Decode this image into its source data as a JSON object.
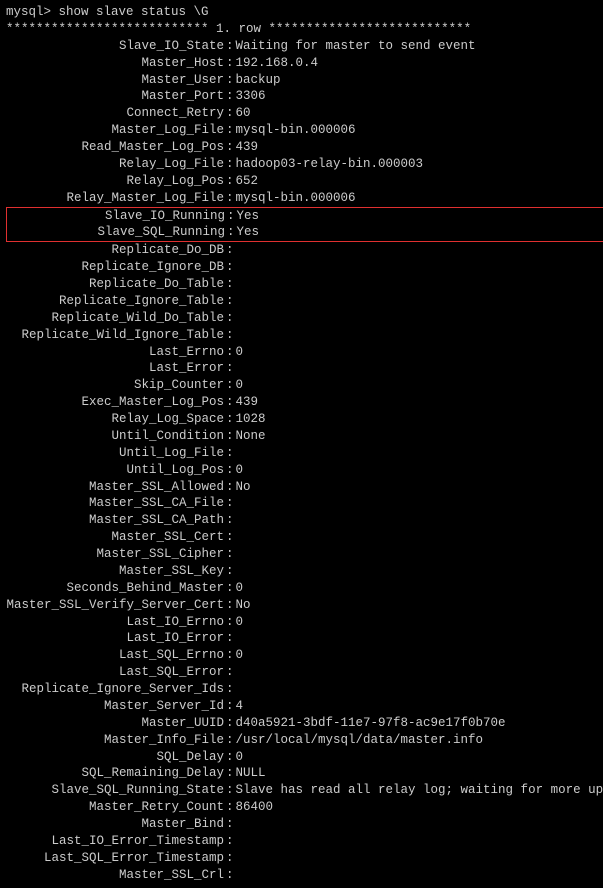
{
  "prompt": "mysql> show slave status \\G",
  "row_divider": "*************************** 1. row ***************************",
  "rows_before_box": [
    {
      "label": "Slave_IO_State",
      "value": "Waiting for master to send event"
    },
    {
      "label": "Master_Host",
      "value": "192.168.0.4"
    },
    {
      "label": "Master_User",
      "value": "backup"
    },
    {
      "label": "Master_Port",
      "value": "3306"
    },
    {
      "label": "Connect_Retry",
      "value": "60"
    },
    {
      "label": "Master_Log_File",
      "value": "mysql-bin.000006"
    },
    {
      "label": "Read_Master_Log_Pos",
      "value": "439"
    },
    {
      "label": "Relay_Log_File",
      "value": "hadoop03-relay-bin.000003"
    },
    {
      "label": "Relay_Log_Pos",
      "value": "652"
    },
    {
      "label": "Relay_Master_Log_File",
      "value": "mysql-bin.000006"
    }
  ],
  "rows_in_box": [
    {
      "label": "Slave_IO_Running",
      "value": "Yes"
    },
    {
      "label": "Slave_SQL_Running",
      "value": "Yes"
    }
  ],
  "rows_after_box": [
    {
      "label": "Replicate_Do_DB",
      "value": ""
    },
    {
      "label": "Replicate_Ignore_DB",
      "value": ""
    },
    {
      "label": "Replicate_Do_Table",
      "value": ""
    },
    {
      "label": "Replicate_Ignore_Table",
      "value": ""
    },
    {
      "label": "Replicate_Wild_Do_Table",
      "value": ""
    },
    {
      "label": "Replicate_Wild_Ignore_Table",
      "value": ""
    },
    {
      "label": "Last_Errno",
      "value": "0"
    },
    {
      "label": "Last_Error",
      "value": ""
    },
    {
      "label": "Skip_Counter",
      "value": "0"
    },
    {
      "label": "Exec_Master_Log_Pos",
      "value": "439"
    },
    {
      "label": "Relay_Log_Space",
      "value": "1028"
    },
    {
      "label": "Until_Condition",
      "value": "None"
    },
    {
      "label": "Until_Log_File",
      "value": ""
    },
    {
      "label": "Until_Log_Pos",
      "value": "0"
    },
    {
      "label": "Master_SSL_Allowed",
      "value": "No"
    },
    {
      "label": "Master_SSL_CA_File",
      "value": ""
    },
    {
      "label": "Master_SSL_CA_Path",
      "value": ""
    },
    {
      "label": "Master_SSL_Cert",
      "value": ""
    },
    {
      "label": "Master_SSL_Cipher",
      "value": ""
    },
    {
      "label": "Master_SSL_Key",
      "value": ""
    },
    {
      "label": "Seconds_Behind_Master",
      "value": "0"
    },
    {
      "label": "Master_SSL_Verify_Server_Cert",
      "value": "No"
    },
    {
      "label": "Last_IO_Errno",
      "value": "0"
    },
    {
      "label": "Last_IO_Error",
      "value": ""
    },
    {
      "label": "Last_SQL_Errno",
      "value": "0"
    },
    {
      "label": "Last_SQL_Error",
      "value": ""
    },
    {
      "label": "Replicate_Ignore_Server_Ids",
      "value": ""
    },
    {
      "label": "Master_Server_Id",
      "value": "4"
    },
    {
      "label": "Master_UUID",
      "value": "d40a5921-3bdf-11e7-97f8-ac9e17f0b70e"
    },
    {
      "label": "Master_Info_File",
      "value": "/usr/local/mysql/data/master.info"
    },
    {
      "label": "SQL_Delay",
      "value": "0"
    },
    {
      "label": "SQL_Remaining_Delay",
      "value": "NULL"
    },
    {
      "label": "Slave_SQL_Running_State",
      "value": "Slave has read all relay log; waiting for more updates"
    },
    {
      "label": "Master_Retry_Count",
      "value": "86400"
    },
    {
      "label": "Master_Bind",
      "value": ""
    },
    {
      "label": "Last_IO_Error_Timestamp",
      "value": ""
    },
    {
      "label": "Last_SQL_Error_Timestamp",
      "value": ""
    },
    {
      "label": "Master_SSL_Crl",
      "value": ""
    }
  ]
}
